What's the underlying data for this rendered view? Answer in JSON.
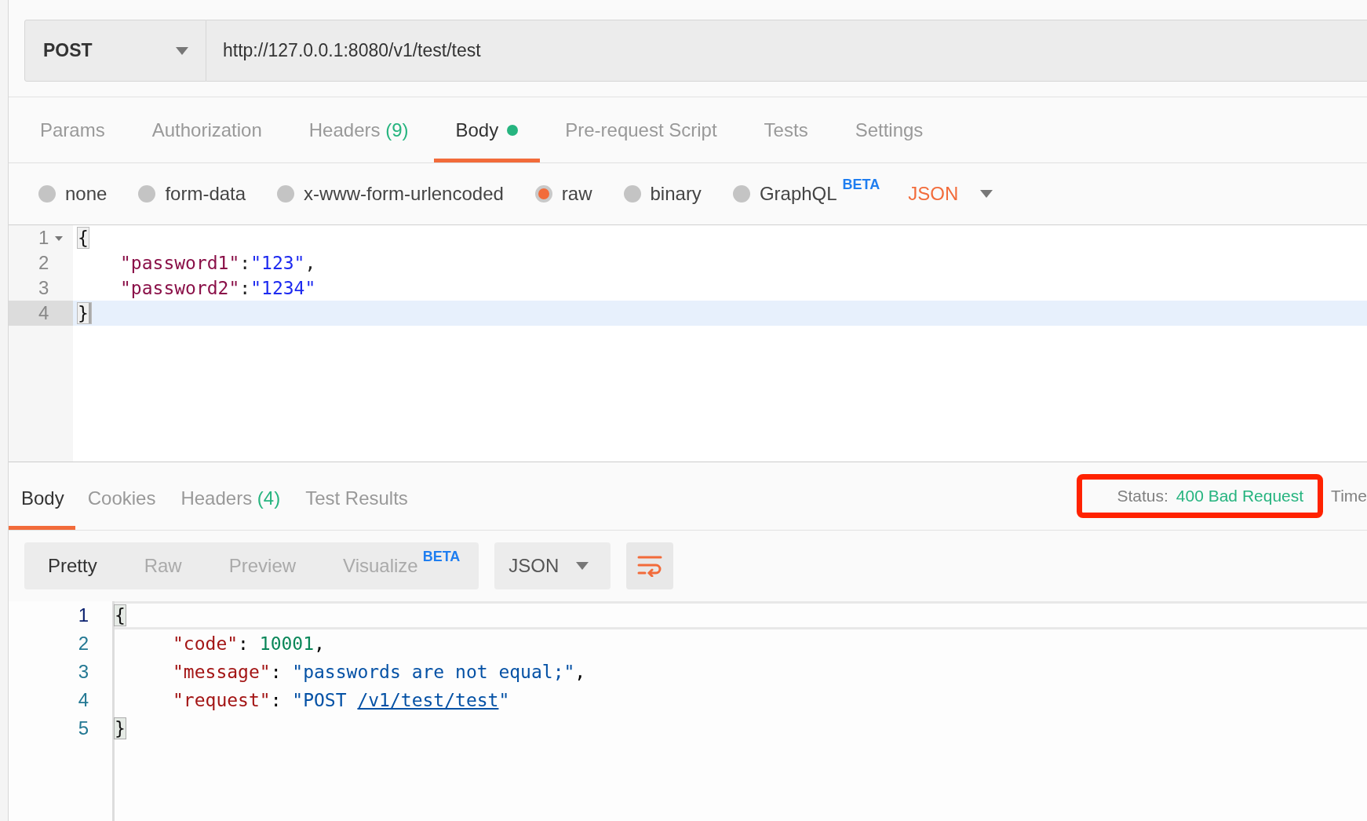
{
  "request_bar": {
    "method": "POST",
    "url": "http://127.0.0.1:8080/v1/test/test"
  },
  "request_tabs": [
    {
      "label": "Params",
      "selected": false,
      "modified": false
    },
    {
      "label": "Authorization",
      "selected": false,
      "modified": false
    },
    {
      "label": "Headers",
      "count": "(9)",
      "selected": false,
      "modified": false
    },
    {
      "label": "Body",
      "selected": true,
      "modified": true
    },
    {
      "label": "Pre-request Script",
      "selected": false,
      "modified": false
    },
    {
      "label": "Tests",
      "selected": false,
      "modified": false
    },
    {
      "label": "Settings",
      "selected": false,
      "modified": false
    }
  ],
  "body_types": [
    {
      "label": "none",
      "selected": false
    },
    {
      "label": "form-data",
      "selected": false
    },
    {
      "label": "x-www-form-urlencoded",
      "selected": false
    },
    {
      "label": "raw",
      "selected": true
    },
    {
      "label": "binary",
      "selected": false
    },
    {
      "label": "GraphQL",
      "badge": "BETA",
      "selected": false
    }
  ],
  "body_format": "JSON",
  "request_body": [
    {
      "number": "1",
      "foldable": true,
      "current": false,
      "tokens": [
        {
          "kind": "bracket",
          "text": "{"
        }
      ]
    },
    {
      "number": "2",
      "foldable": false,
      "current": false,
      "tokens": [
        {
          "kind": "key",
          "text": "\"password1\""
        },
        {
          "kind": "punct",
          "text": ":"
        },
        {
          "kind": "string",
          "text": "\"123\""
        },
        {
          "kind": "punct",
          "text": ","
        }
      ]
    },
    {
      "number": "3",
      "foldable": false,
      "current": false,
      "tokens": [
        {
          "kind": "key",
          "text": "\"password2\""
        },
        {
          "kind": "punct",
          "text": ":"
        },
        {
          "kind": "string",
          "text": "\"1234\""
        }
      ]
    },
    {
      "number": "4",
      "foldable": false,
      "current": true,
      "tokens": [
        {
          "kind": "bracket",
          "text": "}"
        }
      ]
    }
  ],
  "response_tabs": [
    {
      "label": "Body",
      "selected": true
    },
    {
      "label": "Cookies",
      "selected": false
    },
    {
      "label": "Headers",
      "count": "(4)",
      "selected": false
    },
    {
      "label": "Test Results",
      "selected": false
    }
  ],
  "status": {
    "label": "Status:",
    "value": "400 Bad Request",
    "highlighted": true
  },
  "time_label": "Time",
  "view_modes": [
    {
      "label": "Pretty",
      "selected": true
    },
    {
      "label": "Raw",
      "selected": false
    },
    {
      "label": "Preview",
      "selected": false
    },
    {
      "label": "Visualize",
      "badge": "BETA",
      "selected": false
    }
  ],
  "response_format": "JSON",
  "response_body": [
    {
      "number": "1",
      "tokens": [
        {
          "kind": "bracket",
          "text": "{"
        }
      ]
    },
    {
      "number": "2",
      "tokens": [
        {
          "kind": "rkey",
          "text": "\"code\""
        },
        {
          "kind": "punct",
          "text": ": "
        },
        {
          "kind": "number",
          "text": "10001"
        },
        {
          "kind": "punct",
          "text": ","
        }
      ]
    },
    {
      "number": "3",
      "tokens": [
        {
          "kind": "rkey",
          "text": "\"message\""
        },
        {
          "kind": "punct",
          "text": ": "
        },
        {
          "kind": "rstring",
          "text": "\"passwords are not equal;\""
        },
        {
          "kind": "punct",
          "text": ","
        }
      ]
    },
    {
      "number": "4",
      "tokens": [
        {
          "kind": "rkey",
          "text": "\"request\""
        },
        {
          "kind": "punct",
          "text": ": "
        },
        {
          "kind": "rstring",
          "text": "\"POST "
        },
        {
          "kind": "link",
          "text": "/v1/test/test"
        },
        {
          "kind": "rstring",
          "text": "\""
        }
      ]
    },
    {
      "number": "5",
      "tokens": [
        {
          "kind": "bracket",
          "text": "}"
        }
      ]
    }
  ]
}
